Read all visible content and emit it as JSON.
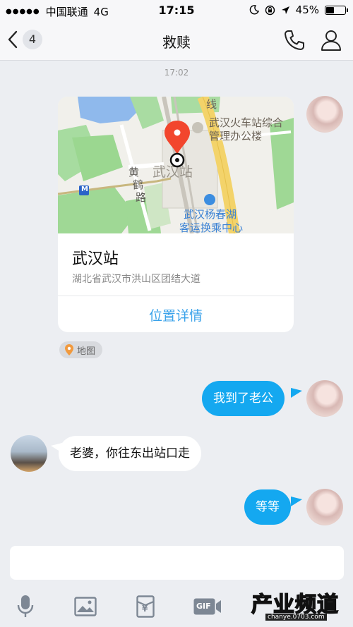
{
  "status": {
    "carrier": "中国联通",
    "network": "4G",
    "time": "17:15",
    "battery": "45%",
    "battery_level": 0.45
  },
  "nav": {
    "back_badge": "4",
    "title": "救赎"
  },
  "chat": {
    "timestamp": "17:02",
    "location_card": {
      "map_labels": {
        "line": "线",
        "station_office": "武汉火车站综合管理办公楼",
        "station_office_line1": "武汉火车站综合",
        "station_office_line2": "管理办公楼",
        "station": "武汉站",
        "road": "黄鹤路",
        "road_char1": "黄",
        "road_char2": "鹤",
        "road_char3": "路",
        "hub_line1": "武汉杨春湖",
        "hub_line2": "客运换乘中心",
        "metro": "M"
      },
      "name": "武汉站",
      "address": "湖北省武汉市洪山区团结大道",
      "link_label": "位置详情"
    },
    "map_chip": "地图",
    "messages": [
      {
        "direction": "out",
        "text": "我到了老公"
      },
      {
        "direction": "in",
        "text": "老婆，你往东出站口走"
      },
      {
        "direction": "out",
        "text": "等等"
      }
    ]
  },
  "toolbar": {
    "icons": [
      "microphone-icon",
      "image-icon",
      "red-packet-icon",
      "gif-icon"
    ],
    "gif_label": "GIF",
    "yen_label": "¥"
  },
  "watermark": {
    "text": "产业频道",
    "url": "chanye.0703.com"
  },
  "colors": {
    "accent": "#3aa2ea",
    "bubble_out": "#14a8f0",
    "pin": "#f2462d"
  }
}
